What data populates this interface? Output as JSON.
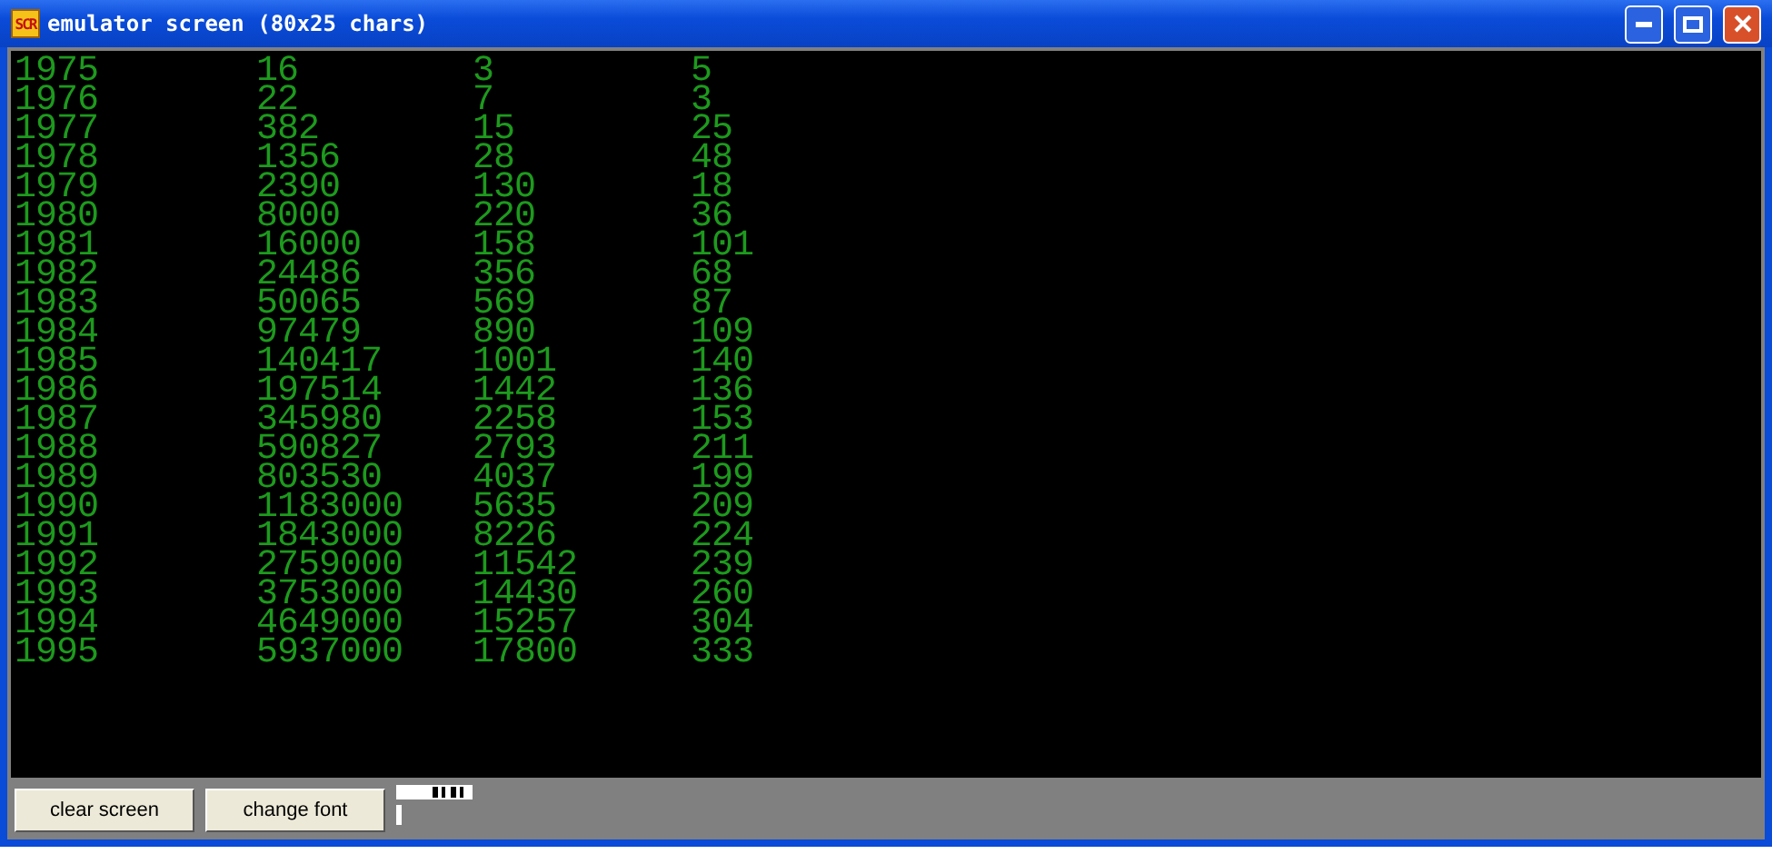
{
  "window": {
    "app_icon": "SCR",
    "title": "emulator screen (80x25 chars)"
  },
  "screen": {
    "rows": [
      [
        "1975",
        "16",
        "3",
        "5"
      ],
      [
        "1976",
        "22",
        "7",
        "3"
      ],
      [
        "1977",
        "382",
        "15",
        "25"
      ],
      [
        "1978",
        "1356",
        "28",
        "48"
      ],
      [
        "1979",
        "2390",
        "130",
        "18"
      ],
      [
        "1980",
        "8000",
        "220",
        "36"
      ],
      [
        "1981",
        "16000",
        "158",
        "101"
      ],
      [
        "1982",
        "24486",
        "356",
        "68"
      ],
      [
        "1983",
        "50065",
        "569",
        "87"
      ],
      [
        "1984",
        "97479",
        "890",
        "109"
      ],
      [
        "1985",
        "140417",
        "1001",
        "140"
      ],
      [
        "1986",
        "197514",
        "1442",
        "136"
      ],
      [
        "1987",
        "345980",
        "2258",
        "153"
      ],
      [
        "1988",
        "590827",
        "2793",
        "211"
      ],
      [
        "1989",
        "803530",
        "4037",
        "199"
      ],
      [
        "1990",
        "1183000",
        "5635",
        "209"
      ],
      [
        "1991",
        "1843000",
        "8226",
        "224"
      ],
      [
        "1992",
        "2759000",
        "11542",
        "239"
      ],
      [
        "1993",
        "3753000",
        "14430",
        "260"
      ],
      [
        "1994",
        "4649000",
        "15257",
        "304"
      ],
      [
        "1995",
        "5937000",
        "17800",
        "333"
      ]
    ]
  },
  "buttons": [
    "clear screen",
    "change font"
  ]
}
